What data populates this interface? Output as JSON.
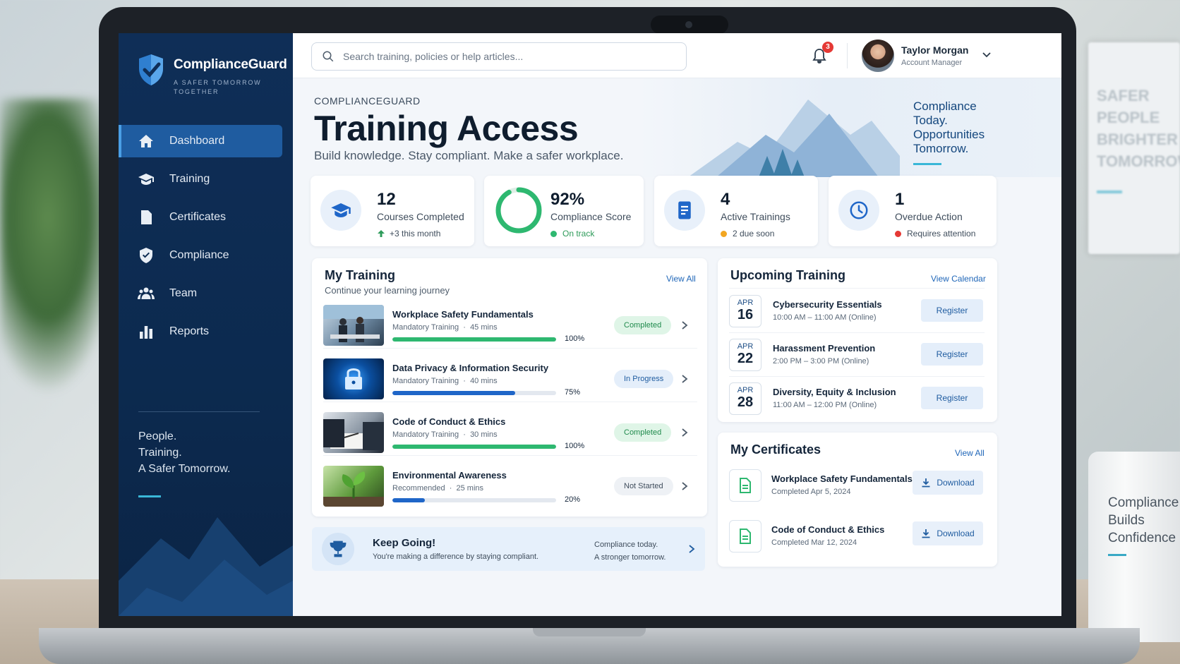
{
  "background": {
    "poster_lines": [
      "SAFER",
      "PEOPLE",
      "BRIGHTER",
      "TOMORROW"
    ],
    "mug_lines": [
      "Compliance",
      "Builds",
      "Confidence"
    ]
  },
  "brand": {
    "name": "ComplianceGuard",
    "tagline": "A SAFER TOMORROW TOGETHER",
    "logo_icon": "shield-check-icon"
  },
  "sidebar": {
    "items": [
      {
        "label": "Dashboard",
        "icon": "home-icon",
        "active": true
      },
      {
        "label": "Training",
        "icon": "graduation-cap-icon",
        "active": false
      },
      {
        "label": "Certificates",
        "icon": "document-icon",
        "active": false
      },
      {
        "label": "Compliance",
        "icon": "shield-check-icon",
        "active": false
      },
      {
        "label": "Team",
        "icon": "team-icon",
        "active": false
      },
      {
        "label": "Reports",
        "icon": "bar-chart-icon",
        "active": false
      }
    ],
    "motto": [
      "People.",
      "Training.",
      "A Safer Tomorrow."
    ]
  },
  "topbar": {
    "search_placeholder": "Search training, policies or help articles...",
    "notification_count": "3",
    "user_name": "Taylor Morgan",
    "user_role": "Account Manager"
  },
  "hero": {
    "kicker": "COMPLIANCEGUARD",
    "title": "Training Access",
    "subtitle": "Build knowledge. Stay compliant. Make a safer workplace.",
    "quote": [
      "Compliance",
      "Today.",
      "Opportunities",
      "Tomorrow."
    ]
  },
  "stats": [
    {
      "value": "12",
      "label": "Courses Completed",
      "note": "+3 this month",
      "note_color": "#2e9b5a",
      "icon": "graduation-cap-icon"
    },
    {
      "value": "92%",
      "label": "Compliance Score",
      "note": "On track",
      "note_color": "#2e9b5a",
      "score_fraction": 0.92
    },
    {
      "value": "4",
      "label": "Active Trainings",
      "note": "2 due soon",
      "note_color": "#f2a621",
      "icon": "document-icon"
    },
    {
      "value": "1",
      "label": "Overdue Action",
      "note": "Requires attention",
      "note_color": "#e53935",
      "icon": "clock-icon"
    }
  ],
  "my_training": {
    "title": "My Training",
    "subtitle": "Continue your learning journey",
    "view_all": "View All",
    "rows": [
      {
        "title": "Workplace Safety Fundamentals",
        "type": "Mandatory Training",
        "duration": "45 mins",
        "progress": "100%",
        "progress_fraction": 1.0,
        "status": "Completed",
        "status_kind": "done",
        "bar_color": "#2eb870"
      },
      {
        "title": "Data Privacy & Information Security",
        "type": "Mandatory Training",
        "duration": "40 mins",
        "progress": "75%",
        "progress_fraction": 0.75,
        "status": "In Progress",
        "status_kind": "progress",
        "bar_color": "#1f66c8"
      },
      {
        "title": "Code of Conduct & Ethics",
        "type": "Mandatory Training",
        "duration": "30 mins",
        "progress": "100%",
        "progress_fraction": 1.0,
        "status": "Completed",
        "status_kind": "done",
        "bar_color": "#2eb870"
      },
      {
        "title": "Environmental Awareness",
        "type": "Recommended",
        "duration": "25 mins",
        "progress": "20%",
        "progress_fraction": 0.2,
        "status": "Not Started",
        "status_kind": "none",
        "bar_color": "#1f66c8"
      }
    ]
  },
  "keep_going": {
    "title": "Keep Going!",
    "subtitle": "You're making a difference by staying compliant.",
    "right_lines": [
      "Compliance today.",
      "A stronger tomorrow."
    ]
  },
  "upcoming": {
    "title": "Upcoming Training",
    "view_calendar": "View Calendar",
    "register_label": "Register",
    "events": [
      {
        "month": "APR",
        "day": "16",
        "title": "Cybersecurity Essentials",
        "time": "10:00 AM – 11:00 AM (Online)"
      },
      {
        "month": "APR",
        "day": "22",
        "title": "Harassment Prevention",
        "time": "2:00 PM – 3:00 PM (Online)"
      },
      {
        "month": "APR",
        "day": "28",
        "title": "Diversity, Equity & Inclusion",
        "time": "11:00 AM – 12:00 PM (Online)"
      }
    ]
  },
  "certificates": {
    "title": "My Certificates",
    "view_all": "View All",
    "download_label": "Download",
    "items": [
      {
        "title": "Workplace Safety Fundamentals",
        "date": "Completed Apr 5, 2024"
      },
      {
        "title": "Code of Conduct & Ethics",
        "date": "Completed Mar 12, 2024"
      }
    ]
  },
  "colors": {
    "sidebar_bg": "#0f2e57",
    "accent": "#1f5ca0",
    "success": "#2eb870",
    "warning": "#f2a621",
    "danger": "#e53935"
  }
}
